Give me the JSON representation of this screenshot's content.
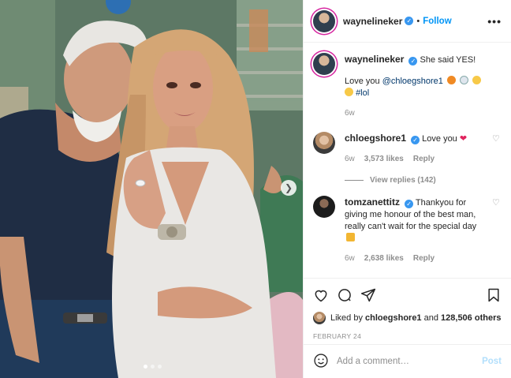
{
  "post": {
    "author": "waynelineker",
    "follow_label": "Follow",
    "more_label": "•••"
  },
  "caption": {
    "author": "waynelineker",
    "line1": "She said YES!",
    "line2_prefix": "Love you ",
    "line2_mention": "@chloegshore1",
    "hashtag": "#lol",
    "age": "6w"
  },
  "comments": [
    {
      "author": "chloegshore1",
      "text": "Love you",
      "age": "6w",
      "likes": "3,573 likes",
      "reply_label": "Reply",
      "view_replies": "View replies (142)"
    },
    {
      "author": "tomzanettitz",
      "text": "Thankyou for giving me honour of the best man, really can't wait for the special day",
      "age": "6w",
      "likes": "2,638 likes",
      "reply_label": "Reply"
    }
  ],
  "likes": {
    "prefix": "Liked by ",
    "user": "chloegshore1",
    "mid": " and ",
    "count": "128,506 others"
  },
  "date": "FEBRUARY 24",
  "comment_box": {
    "placeholder": "Add a comment…",
    "post_label": "Post"
  },
  "carousel": {
    "slide_count": 3,
    "active_index": 0
  },
  "colors": {
    "verified": "#3897f0",
    "follow": "#0095f6",
    "heart": "#ed4956",
    "post_disabled": "#b2dffc"
  },
  "icons": [
    "heart-icon",
    "comment-icon",
    "share-icon",
    "bookmark-icon",
    "emoji-icon",
    "chevron-right-icon",
    "verified-badge-icon"
  ]
}
